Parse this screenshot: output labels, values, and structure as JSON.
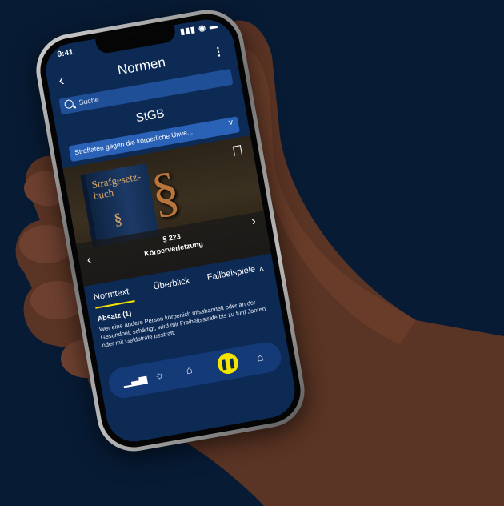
{
  "status_bar": {
    "time": "9:41",
    "icons": "▮▮▮ ◉ ▬"
  },
  "header": {
    "back_icon": "‹",
    "title": "Normen",
    "menu_icon": "⋮"
  },
  "search": {
    "placeholder": "Suche"
  },
  "law": {
    "code": "StGB"
  },
  "dropdown": {
    "selected": "Straftaten gegen die körperliche Unve...",
    "chevron": "˅"
  },
  "hero": {
    "book_title": "Strafgesetz-\nbuch",
    "book_mark": "§",
    "symbol": "§",
    "section_number": "§ 223",
    "section_name": "Körperverletzung",
    "prev_icon": "‹",
    "next_icon": "›"
  },
  "tabs": {
    "items": [
      "Normtext",
      "Überblick",
      "Fallbeispiele"
    ],
    "active_index": 0,
    "collapse_icon": "˄"
  },
  "content": {
    "heading": "Absatz (1)",
    "text": "Wer eine andere Person körperlich misshandelt oder an der Gesundheit schädigt, wird mit Freiheitsstrafe bis zu fünf Jahren oder mit Geldstrafe bestraft."
  },
  "nav": {
    "icons": [
      "chart-icon",
      "lightbulb-icon",
      "graduation-icon",
      "pause-icon",
      "home-icon"
    ],
    "glyphs": [
      "▁▃▅",
      "☼",
      "⌂",
      "❚❚",
      "⌂"
    ]
  },
  "colors": {
    "background": "#071b35",
    "screen": "#0d2a55",
    "accent_yellow": "#f5e400",
    "dropdown": "#2a62b8"
  }
}
